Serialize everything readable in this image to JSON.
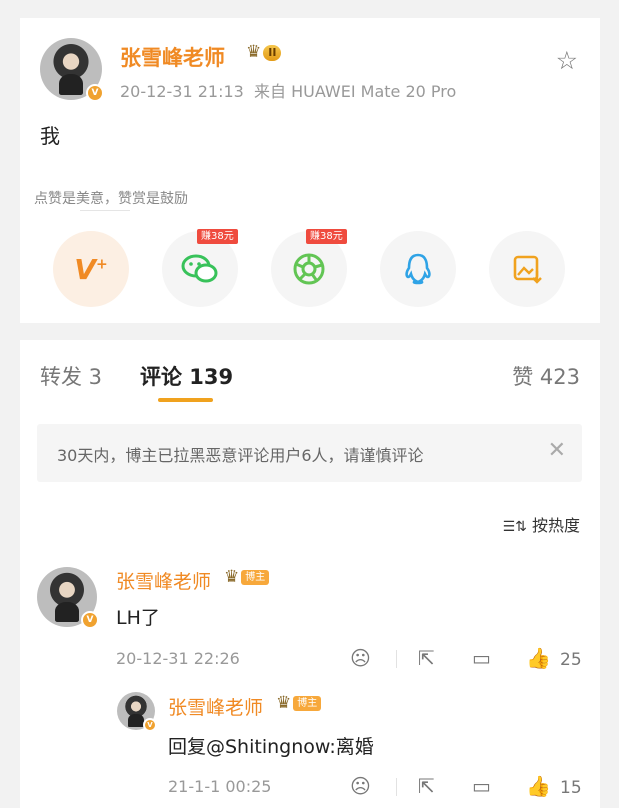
{
  "post": {
    "author": "张雪峰老师",
    "level_badge": "II",
    "verified_mark": "V",
    "time": "20-12-31 21:13",
    "source": "来自 HUAWEI Mate 20 Pro",
    "content": "我",
    "reward_tip": "点赞是美意，赞赏是鼓励",
    "share_targets": [
      {
        "name": "reward-vplus",
        "icon": "V+",
        "color": "#f08a24",
        "earn": ""
      },
      {
        "name": "wechat",
        "icon": "wechat-icon",
        "color": "#38c25a",
        "earn": "赚38元"
      },
      {
        "name": "moments",
        "icon": "moments-icon",
        "color": "#62c554",
        "earn": "赚38元"
      },
      {
        "name": "qq",
        "icon": "qq-icon",
        "color": "#2fa3e6",
        "earn": ""
      },
      {
        "name": "save-image",
        "icon": "save-image-icon",
        "color": "#f0a21e",
        "earn": ""
      }
    ]
  },
  "tabs": {
    "forward": "转发 3",
    "comments": "评论 139",
    "likes": "赞 423"
  },
  "notice": "30天内，博主已拉黑恶意评论用户6人，请谨慎评论",
  "sort_label": "按热度",
  "comments": [
    {
      "author": "张雪峰老师",
      "host_tag": "博主",
      "text": "LH了",
      "time": "20-12-31 22:26",
      "likes": "25"
    },
    {
      "author": "张雪峰老师",
      "host_tag": "博主",
      "text": "回复@Shitingnow:离婚",
      "time": "21-1-1 00:25",
      "likes": "15"
    }
  ],
  "colors": {
    "accent": "#f08a24",
    "tab_underline": "#f0a21e",
    "earn_badge": "#ef4b3e"
  }
}
